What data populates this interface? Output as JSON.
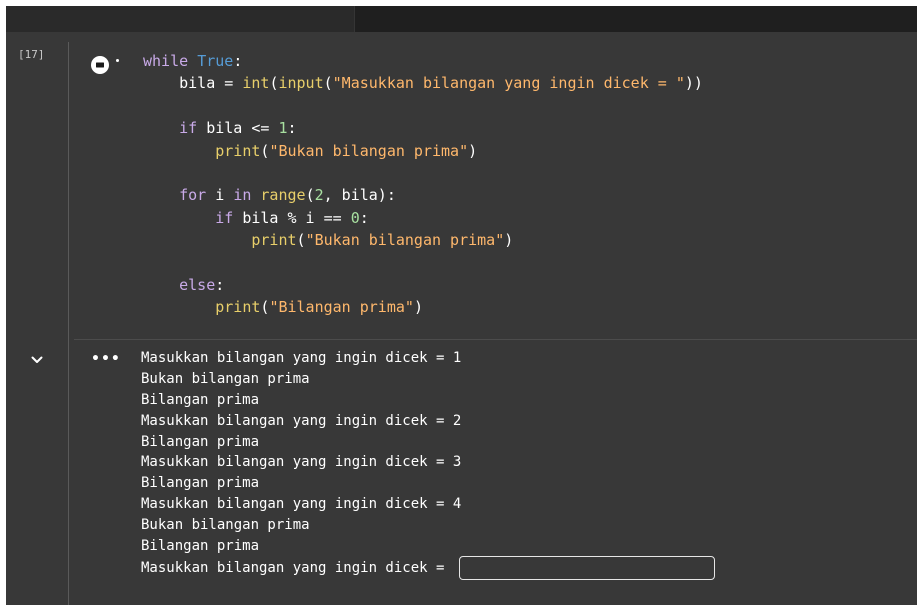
{
  "cell": {
    "execution_count": "[17]",
    "code_lines": [
      [
        {
          "t": "",
          "c": ""
        },
        {
          "t": "while",
          "c": "kw"
        },
        {
          "t": " ",
          "c": ""
        },
        {
          "t": "True",
          "c": "bool"
        },
        {
          "t": ":",
          "c": ""
        }
      ],
      [
        {
          "t": "    bila = ",
          "c": ""
        },
        {
          "t": "int",
          "c": "fn"
        },
        {
          "t": "(",
          "c": ""
        },
        {
          "t": "input",
          "c": "fn"
        },
        {
          "t": "(",
          "c": ""
        },
        {
          "t": "\"Masukkan bilangan yang ingin dicek = \"",
          "c": "str"
        },
        {
          "t": "))",
          "c": ""
        }
      ],
      [],
      [
        {
          "t": "    ",
          "c": ""
        },
        {
          "t": "if",
          "c": "kw"
        },
        {
          "t": " bila <= ",
          "c": ""
        },
        {
          "t": "1",
          "c": "num"
        },
        {
          "t": ":",
          "c": ""
        }
      ],
      [
        {
          "t": "        ",
          "c": ""
        },
        {
          "t": "print",
          "c": "fn"
        },
        {
          "t": "(",
          "c": ""
        },
        {
          "t": "\"Bukan bilangan prima\"",
          "c": "str"
        },
        {
          "t": ")",
          "c": ""
        }
      ],
      [],
      [
        {
          "t": "    ",
          "c": ""
        },
        {
          "t": "for",
          "c": "kw"
        },
        {
          "t": " i ",
          "c": ""
        },
        {
          "t": "in",
          "c": "kw"
        },
        {
          "t": " ",
          "c": ""
        },
        {
          "t": "range",
          "c": "fn"
        },
        {
          "t": "(",
          "c": ""
        },
        {
          "t": "2",
          "c": "num"
        },
        {
          "t": ", bila):",
          "c": ""
        }
      ],
      [
        {
          "t": "        ",
          "c": ""
        },
        {
          "t": "if",
          "c": "kw"
        },
        {
          "t": " bila % i == ",
          "c": ""
        },
        {
          "t": "0",
          "c": "num"
        },
        {
          "t": ":",
          "c": ""
        }
      ],
      [
        {
          "t": "            ",
          "c": ""
        },
        {
          "t": "print",
          "c": "fn"
        },
        {
          "t": "(",
          "c": ""
        },
        {
          "t": "\"Bukan bilangan prima\"",
          "c": "str"
        },
        {
          "t": ")",
          "c": ""
        }
      ],
      [],
      [
        {
          "t": "    ",
          "c": ""
        },
        {
          "t": "else",
          "c": "kw"
        },
        {
          "t": ":",
          "c": ""
        }
      ],
      [
        {
          "t": "        ",
          "c": ""
        },
        {
          "t": "print",
          "c": "fn"
        },
        {
          "t": "(",
          "c": ""
        },
        {
          "t": "\"Bilangan prima\"",
          "c": "str"
        },
        {
          "t": ")",
          "c": ""
        }
      ]
    ],
    "output_menu_label": "•••",
    "output_lines": [
      "Masukkan bilangan yang ingin dicek = 1",
      "Bukan bilangan prima",
      "Bilangan prima",
      "Masukkan bilangan yang ingin dicek = 2",
      "Bilangan prima",
      "Masukkan bilangan yang ingin dicek = 3",
      "Bilangan prima",
      "Masukkan bilangan yang ingin dicek = 4",
      "Bukan bilangan prima",
      "Bilangan prima"
    ],
    "input_prompt": "Masukkan bilangan yang ingin dicek = ",
    "input_value": ""
  },
  "icons": {
    "run": "run-cell-icon",
    "collapse": "chevron-down-icon",
    "output_menu": "more-horizontal-icon"
  },
  "colors": {
    "background": "#383838",
    "keyword": "#c9aae8",
    "function": "#e8cf6a",
    "string": "#ffb86c",
    "number": "#a8e0a0",
    "boolean": "#569cd6",
    "text": "#ffffff"
  }
}
